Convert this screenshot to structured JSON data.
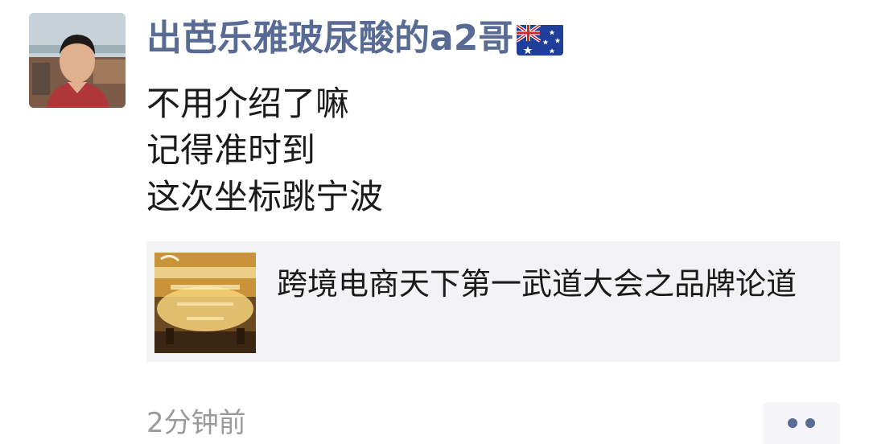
{
  "post": {
    "username": "出芭乐雅玻尿酸的a2哥",
    "flag_icon": "australia-flag-icon",
    "content_lines": [
      "不用介绍了嘛",
      "记得准时到",
      "这次坐标跳宁波"
    ],
    "link": {
      "title": "跨境电商天下第一武道大会之品牌论道",
      "thumbnail_icon": "event-banner-thumbnail"
    },
    "timestamp": "2分钟前",
    "more_icon": "more-dots-icon"
  },
  "colors": {
    "username": "#576b95",
    "text": "#1a1a1a",
    "timestamp": "#9a9a9a",
    "card_bg": "#f3f3f5"
  }
}
